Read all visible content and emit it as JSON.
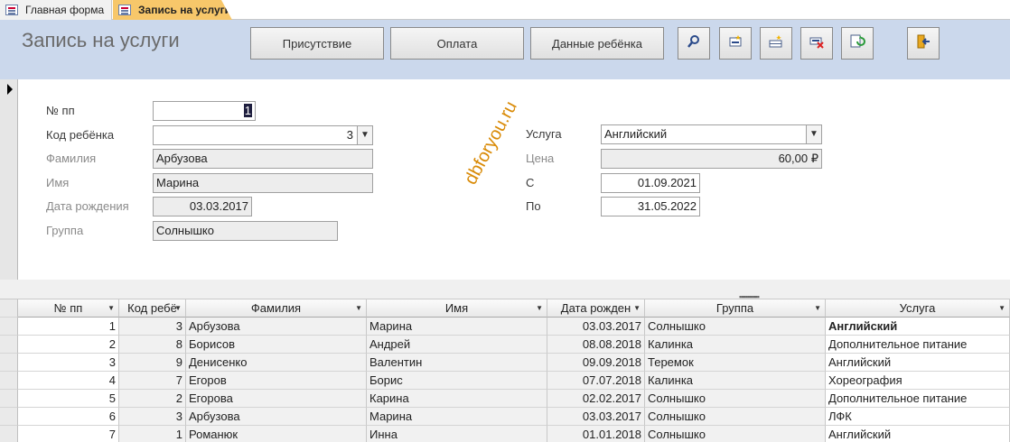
{
  "tabs": [
    {
      "label": "Главная форма",
      "active": false
    },
    {
      "label": "Запись на услуги",
      "active": true
    }
  ],
  "header": {
    "title": "Запись на услуги",
    "buttons": [
      "Присутствие",
      "Оплата",
      "Данные ребёнка"
    ],
    "icon_buttons": [
      "search-icon",
      "new-record-icon",
      "add-record-icon",
      "delete-record-icon",
      "refresh-icon",
      "exit-icon"
    ]
  },
  "form": {
    "labels": {
      "num": "№ пп",
      "child_code": "Код ребёнка",
      "last_name": "Фамилия",
      "first_name": "Имя",
      "birth_date": "Дата рождения",
      "group": "Группа",
      "service": "Услуга",
      "price": "Цена",
      "from": "С",
      "to": "По"
    },
    "values": {
      "num": "1",
      "child_code": "3",
      "last_name": "Арбузова",
      "first_name": "Марина",
      "birth_date": "03.03.2017",
      "group": "Солнышко",
      "service": "Английский",
      "price": "60,00 ₽",
      "from": "01.09.2021",
      "to": "31.05.2022"
    }
  },
  "watermark": "dbforyou.ru",
  "table": {
    "columns": [
      "№ пп",
      "Код ребё",
      "Фамилия",
      "Имя",
      "Дата рожден",
      "Группа",
      "Услуга"
    ],
    "rows": [
      [
        "1",
        "3",
        "Арбузова",
        "Марина",
        "03.03.2017",
        "Солнышко",
        "Английский"
      ],
      [
        "2",
        "8",
        "Борисов",
        "Андрей",
        "08.08.2018",
        "Калинка",
        "Дополнительное питание"
      ],
      [
        "3",
        "9",
        "Денисенко",
        "Валентин",
        "09.09.2018",
        "Теремок",
        "Английский"
      ],
      [
        "4",
        "7",
        "Егоров",
        "Борис",
        "07.07.2018",
        "Калинка",
        "Хореография"
      ],
      [
        "5",
        "2",
        "Егорова",
        "Карина",
        "02.02.2017",
        "Солнышко",
        "Дополнительное питание"
      ],
      [
        "6",
        "3",
        "Арбузова",
        "Марина",
        "03.03.2017",
        "Солнышко",
        "ЛФК"
      ],
      [
        "7",
        "1",
        "Романюк",
        "Инна",
        "01.01.2018",
        "Солнышко",
        "Английский"
      ]
    ]
  },
  "colors": {
    "header_bg": "#cbd8ec",
    "active_tab": "#f7c76a",
    "watermark": "#d98a06"
  }
}
